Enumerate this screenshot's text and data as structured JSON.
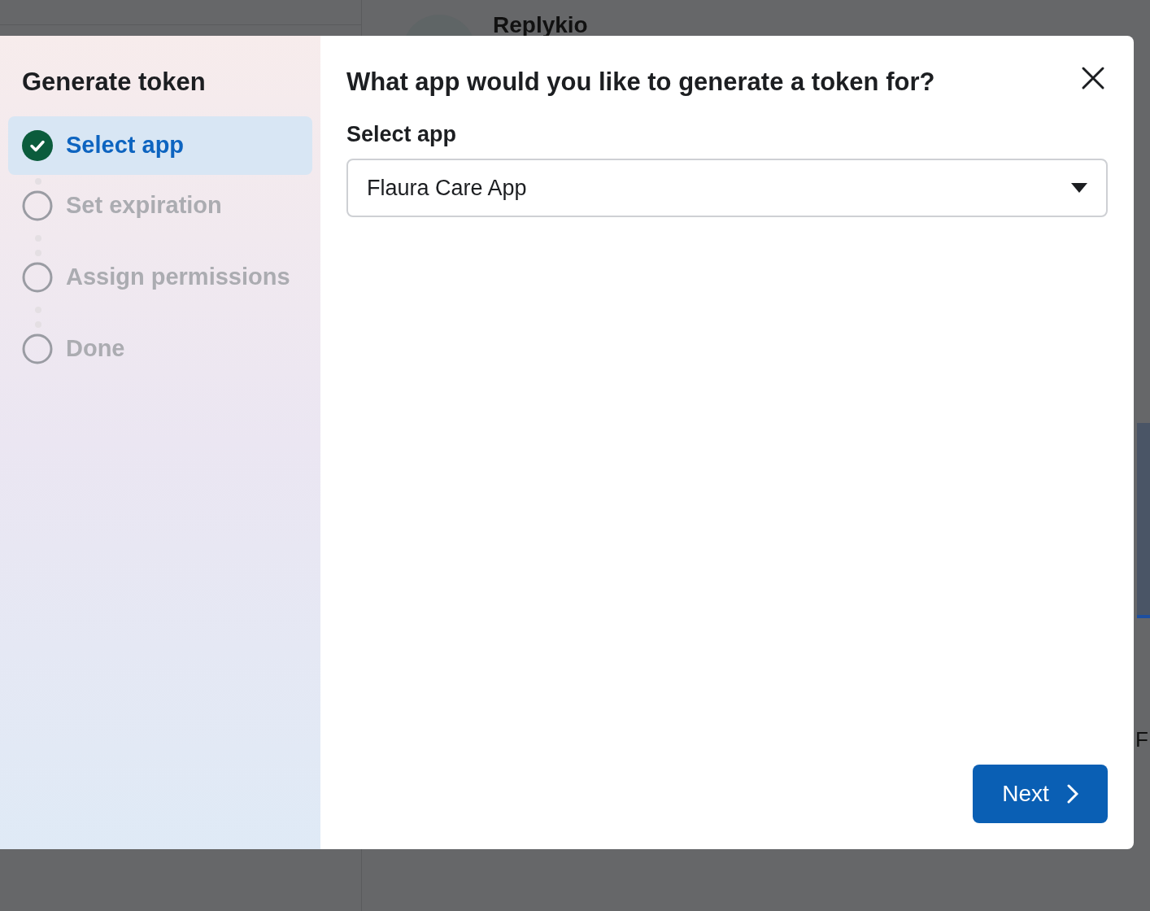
{
  "background": {
    "title": "Replykio",
    "side_text": "F"
  },
  "sidebar": {
    "title": "Generate token",
    "steps": [
      {
        "label": "Select app",
        "completed": true,
        "selected": true
      },
      {
        "label": "Set expiration",
        "completed": false,
        "selected": false
      },
      {
        "label": "Assign permissions",
        "completed": false,
        "selected": false
      },
      {
        "label": "Done",
        "completed": false,
        "selected": false
      }
    ]
  },
  "dialog": {
    "heading": "What app would you like to generate a token for?",
    "field_label": "Select app",
    "select_value": "Flaura Care App",
    "next_button": "Next"
  }
}
